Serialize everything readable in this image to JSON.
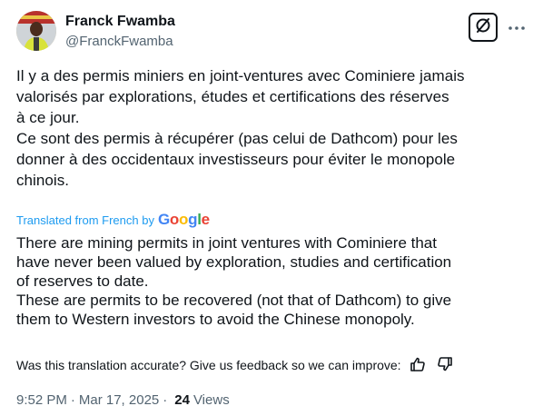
{
  "author": {
    "display_name": "Franck Fwamba",
    "handle": "@FranckFwamba"
  },
  "header": {
    "grok_icon": "grok-slash-icon",
    "more_icon": "more-dots-icon"
  },
  "tweet": {
    "text": "Il y a des permis miniers en joint-ventures avec Cominiere jamais\nvalorisés par explorations, études et certifications des réserves\nà ce jour.\nCe sont des permis à récupérer (pas celui de Dathcom) pour les\ndonner à des occidentaux investisseurs pour éviter le monopole\nchinois."
  },
  "translation": {
    "label": "Translated from French by",
    "provider": "Google",
    "provider_colors": [
      "#4285F4",
      "#EA4335",
      "#FBBC05",
      "#4285F4",
      "#34A853",
      "#EA4335"
    ],
    "text": "There are mining permits in joint ventures with Cominiere that\nhave never been valued by exploration, studies and certification\nof reserves to date.\nThese are permits to be recovered (not that of Dathcom) to give\nthem to Western investors to avoid the Chinese monopoly.",
    "feedback_prompt": "Was this translation accurate? Give us feedback so we can improve:"
  },
  "meta": {
    "time": "9:52 PM",
    "separator": "·",
    "date": "Mar 17, 2025",
    "separator2": "·",
    "views_count": "24",
    "views_label": "Views"
  },
  "colors": {
    "link": "#1d9bf0",
    "secondary": "#536471",
    "primary": "#0f1419"
  }
}
